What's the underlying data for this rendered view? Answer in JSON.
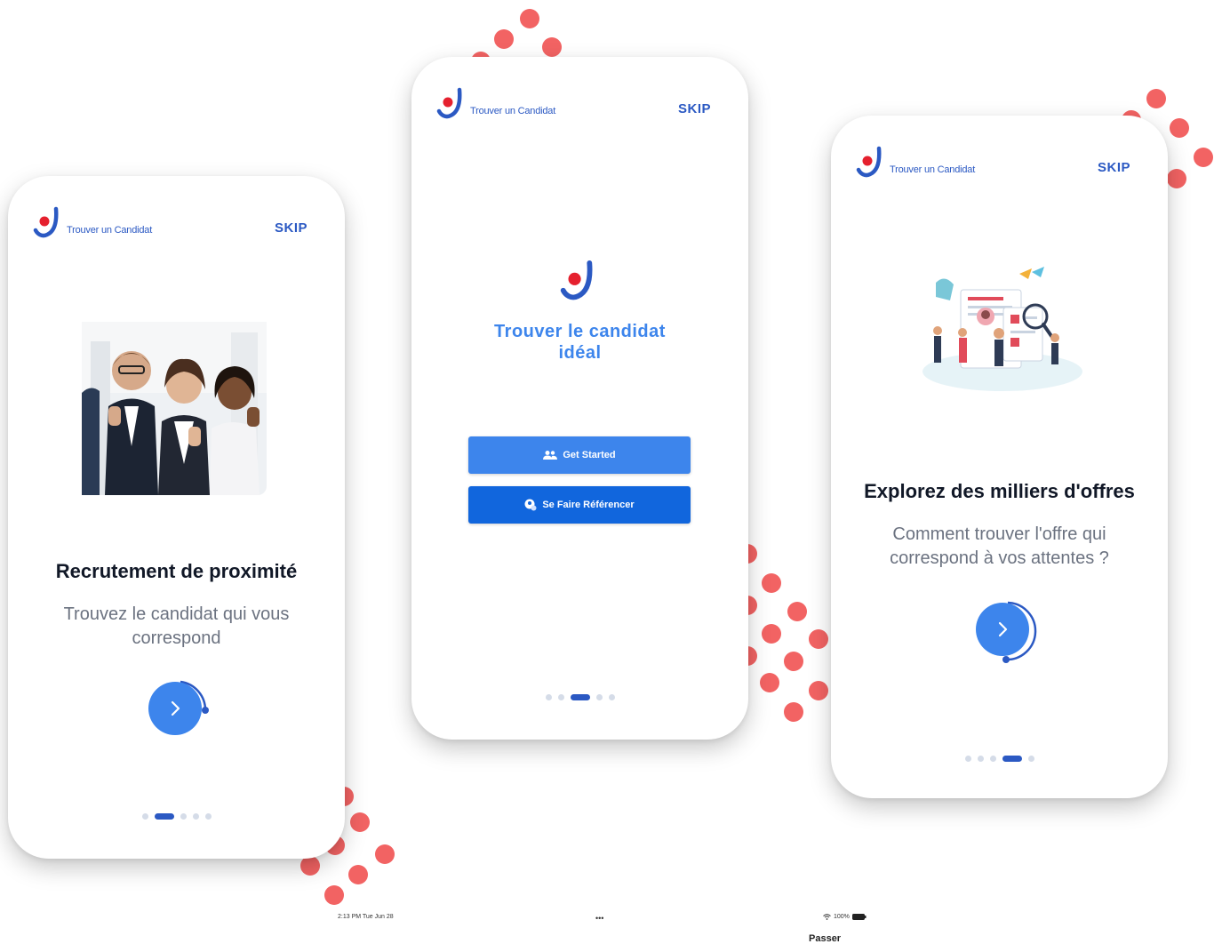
{
  "brand": {
    "name": "Trouver un Candidat",
    "blue": "#2b59c3",
    "red": "#e5202e",
    "accent_dots": "#f26363"
  },
  "screens": [
    {
      "skip_label": "SKIP",
      "title": "Recrutement de proximité",
      "subtitle": "Trouvez le candidat qui vous correspond",
      "next_icon": "chevron-right-icon",
      "pagination": {
        "count": 5,
        "active": 1
      }
    },
    {
      "skip_label": "SKIP",
      "title": "Trouver le candidat idéal",
      "buttons": [
        {
          "label": "Get Started",
          "icon": "users-icon"
        },
        {
          "label": "Se Faire Référencer",
          "icon": "user-badge-icon"
        }
      ],
      "pagination": {
        "count": 5,
        "active": 2
      }
    },
    {
      "skip_label": "SKIP",
      "title": "Explorez des milliers d'offres",
      "subtitle": "Comment trouver l'offre qui correspond à vos attentes ?",
      "next_icon": "chevron-right-icon",
      "pagination": {
        "count": 5,
        "active": 3
      }
    }
  ],
  "statusbar": {
    "time": "2:13 PM  Tue Jun 28",
    "dots": "•••",
    "battery": "100%"
  },
  "footer": {
    "passer_label": "Passer"
  }
}
